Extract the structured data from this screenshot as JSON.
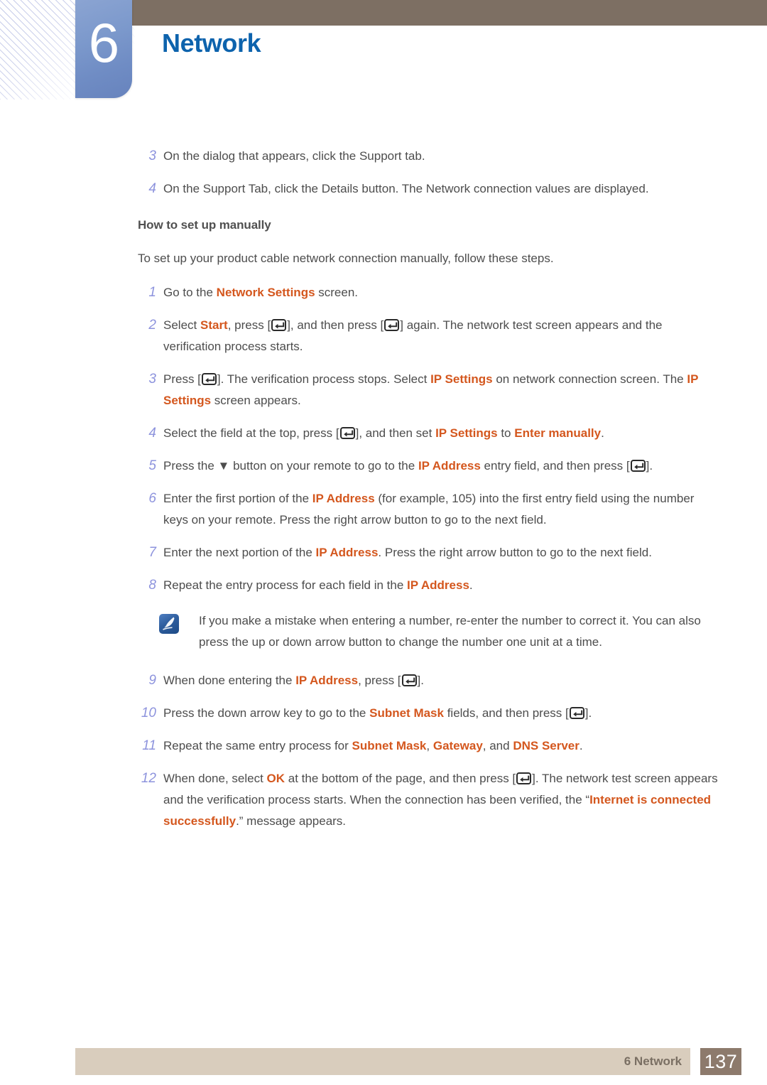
{
  "header": {
    "chapter_number": "6",
    "chapter_title": "Network",
    "accent_blue": "#0d63ad",
    "tab_blue": "#7c99cc",
    "bar_brown": "#7d6f63"
  },
  "colors": {
    "highlight_orange": "#d4571e",
    "step_number": "#8d93dd",
    "body_text": "#4d4d4d",
    "footer_bar": "#d9cdbd",
    "footer_page_box": "#8d7a6c"
  },
  "icons": {
    "enter_key": "enter-key-icon",
    "note": "note-pencil-icon",
    "down_arrow": "▼"
  },
  "intro_steps": [
    {
      "num": "3",
      "text": "On the dialog that appears, click the Support tab."
    },
    {
      "num": "4",
      "text": "On the Support Tab, click the Details button. The Network connection values are displayed."
    }
  ],
  "subheading": "How to set up manually",
  "intro_paragraph": "To set up your product cable network connection manually, follow these steps.",
  "manual_steps": {
    "s1": {
      "num": "1",
      "a": "Go to the ",
      "hl1": "Network Settings",
      "b": " screen."
    },
    "s2": {
      "num": "2",
      "a": "Select ",
      "hl1": "Start",
      "b": ", press [",
      "c": "], and then press [",
      "d": "] again. The network test screen appears and the verification process starts."
    },
    "s3": {
      "num": "3",
      "a": "Press [",
      "b": "]. The verification process stops. Select ",
      "hl1": "IP Settings",
      "c": " on network connection screen. The ",
      "hl2": "IP Settings",
      "d": " screen appears."
    },
    "s4": {
      "num": "4",
      "a": "Select the field at the top, press [",
      "b": "], and then set ",
      "hl1": "IP Settings",
      "c": " to ",
      "hl2": "Enter manually",
      "d": "."
    },
    "s5": {
      "num": "5",
      "a": "Press the ",
      "arrow": "▼",
      "b": " button on your remote to go to the ",
      "hl1": "IP Address",
      "c": " entry field, and then press [",
      "d": "]."
    },
    "s6": {
      "num": "6",
      "a": "Enter the first portion of the ",
      "hl1": "IP Address",
      "b": " (for example, 105) into the first entry field using the number keys on your remote. Press the right arrow button to go to the next field."
    },
    "s7": {
      "num": "7",
      "a": "Enter the next portion of the ",
      "hl1": "IP Address",
      "b": ". Press the right arrow button to go to the next field."
    },
    "s8": {
      "num": "8",
      "a": "Repeat the entry process for each field in the ",
      "hl1": "IP Address",
      "b": "."
    },
    "s9": {
      "num": "9",
      "a": "When done entering the ",
      "hl1": "IP Address",
      "b": ", press [",
      "c": "]."
    },
    "s10": {
      "num": "10",
      "a": "Press the down arrow key to go to the ",
      "hl1": "Subnet Mask",
      "b": " fields, and then press [",
      "c": "]."
    },
    "s11": {
      "num": "11",
      "a": "Repeat the same entry process for ",
      "hl1": "Subnet Mask",
      "b": ", ",
      "hl2": "Gateway",
      "c": ", and ",
      "hl3": "DNS Server",
      "d": "."
    },
    "s12": {
      "num": "12",
      "a": "When done, select ",
      "hl1": "OK",
      "b": " at the bottom of the page, and then press [",
      "c": "]. The network test screen appears and the verification process starts. When the connection has been verified, the “",
      "hl2": "Internet is connected successfully",
      "d": ".” message appears."
    }
  },
  "note": {
    "text": "If you make a mistake when entering a number, re-enter the number to correct it. You can also press the up or down arrow button to change the number one unit at a time."
  },
  "footer": {
    "label": "6 Network",
    "page": "137"
  }
}
